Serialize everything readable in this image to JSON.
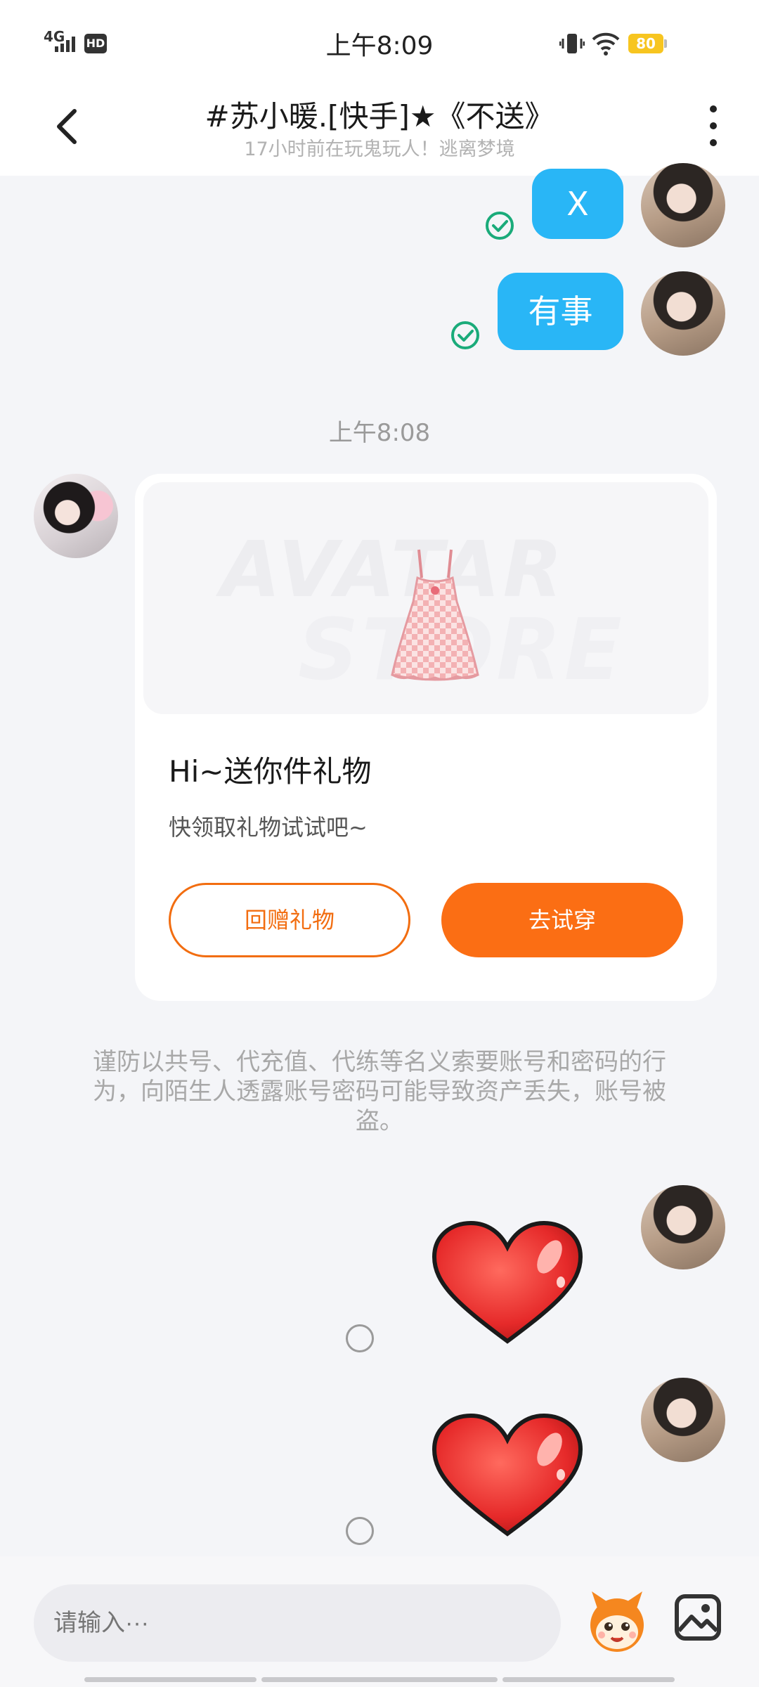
{
  "status_bar": {
    "network": "4G",
    "hd_label": "HD",
    "time": "上午8:09",
    "battery": "80"
  },
  "header": {
    "title": "#苏小暖.[快手]★《不送》",
    "subtitle": "17小时前在玩鬼玩人！逃离梦境"
  },
  "messages": [
    {
      "from": "me",
      "text": "X",
      "status": "read"
    },
    {
      "from": "me",
      "text": "有事",
      "status": "read"
    }
  ],
  "timestamp": "上午8:08",
  "gift_card": {
    "watermark_line1": "AVATAR",
    "watermark_line2": "STORE",
    "title": "Hi~送你件礼物",
    "description": "快领取礼物试试吧~",
    "return_gift_label": "回赠礼物",
    "try_on_label": "去试穿"
  },
  "warning": "谨防以共号、代充值、代练等名义索要账号和密码的行为，向陌生人透露账号密码可能导致资产丢失，账号被盗。",
  "heart_messages": [
    {
      "from": "me",
      "type": "heart-sticker",
      "status": "unread"
    },
    {
      "from": "me",
      "type": "heart-sticker",
      "status": "unread"
    }
  ],
  "input": {
    "placeholder": "请输入···"
  },
  "colors": {
    "bubble": "#29b6f6",
    "accent": "#fb6e14",
    "read": "#1aab7a",
    "battery": "#f7c520"
  }
}
